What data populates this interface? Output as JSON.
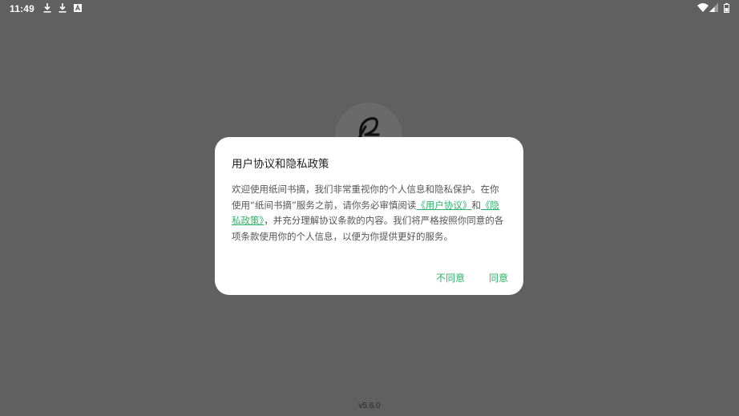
{
  "status_bar": {
    "time": "11:49",
    "left_icons": [
      "download-icon",
      "download-icon",
      "notification-a-icon"
    ],
    "right_icons": [
      "wifi-icon",
      "cellular-signal-icon",
      "battery-icon"
    ]
  },
  "app": {
    "logo_icon": "app-logo-icon",
    "version": "v5.6.0"
  },
  "dialog": {
    "title": "用户协议和隐私政策",
    "body_part1": "欢迎使用纸间书摘，我们非常重视你的个人信息和隐私保护。在你使用“纸间书摘”服务之前，请你务必审慎阅读",
    "user_agreement_link": "《用户协议》",
    "body_and": "和",
    "privacy_link": "《隐私政策》",
    "body_part2": "，并充分理解协议条款的内容。我们将严格按照你同意的各项条款使用你的个人信息，以便为你提供更好的服务。",
    "disagree_label": "不同意",
    "agree_label": "同意"
  },
  "colors": {
    "scrim": "#606060",
    "accent": "#2fb36a",
    "dialog_bg": "#ffffff"
  }
}
